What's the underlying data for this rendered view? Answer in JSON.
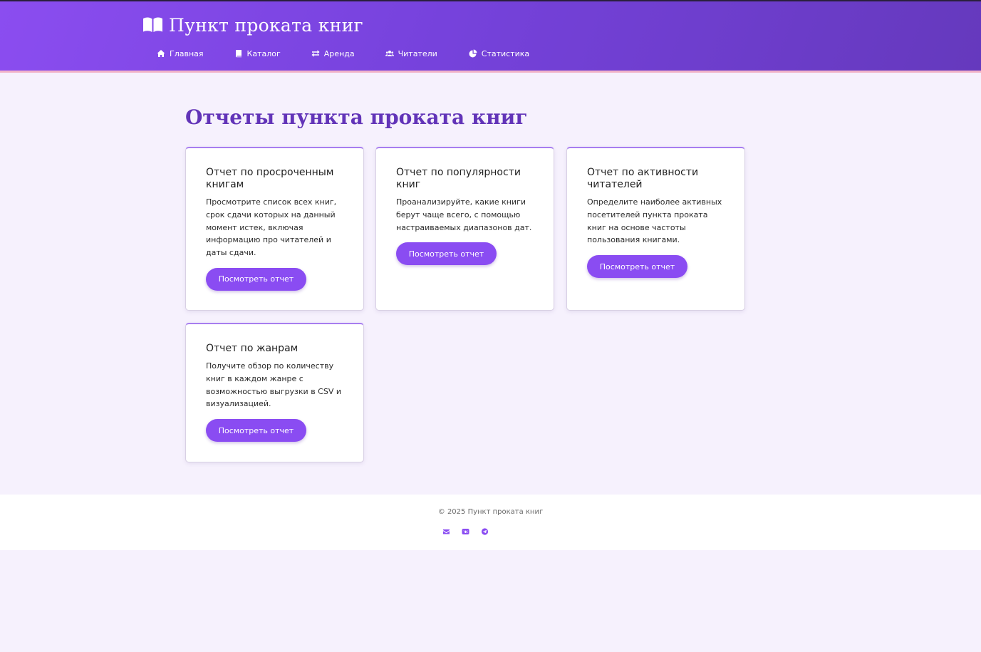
{
  "header": {
    "brand_icon": "open-book-icon",
    "brand_title": "Пункт проката книг",
    "nav": [
      {
        "label": "Главная",
        "icon": "home-icon"
      },
      {
        "label": "Каталог",
        "icon": "book-icon"
      },
      {
        "label": "Аренда",
        "icon": "exchange-arrows-icon"
      },
      {
        "label": "Читатели",
        "icon": "users-icon"
      },
      {
        "label": "Статистика",
        "icon": "pie-chart-icon"
      }
    ]
  },
  "main": {
    "title": "Отчеты пункта проката книг",
    "cards": [
      {
        "title": "Отчет по просроченным книгам",
        "description": "Просмотрите список всех книг, срок сдачи которых на данный момент истек, включая информацию про читателей и даты сдачи.",
        "button": "Посмотреть отчет"
      },
      {
        "title": "Отчет по популярности книг",
        "description": "Проанализируйте, какие книги берут чаще всего, с помощью настраиваемых диапазонов дат.",
        "button": "Посмотреть отчет"
      },
      {
        "title": "Отчет по активности читателей",
        "description": "Определите наиболее активных посетителей пункта проката книг на основе частоты пользования книгами.",
        "button": "Посмотреть отчет"
      },
      {
        "title": "Отчет по жанрам",
        "description": "Получите обзор по количеству книг в каждом жанре с возможностью выгрузки в CSV и визуализацией.",
        "button": "Посмотреть отчет"
      }
    ]
  },
  "footer": {
    "copyright": "© 2025 Пункт проката книг",
    "social_icons": [
      "envelope-icon",
      "vk-icon",
      "telegram-icon"
    ]
  },
  "colors": {
    "accent": "#8a4cf2",
    "title": "#6234b8",
    "header_gradient_start": "#8b4df0",
    "header_gradient_end": "#6539bd",
    "background": "#f6f1fd"
  }
}
